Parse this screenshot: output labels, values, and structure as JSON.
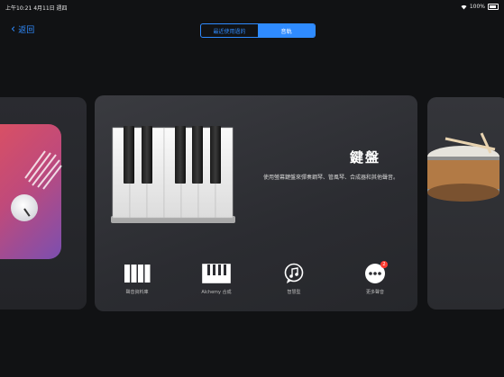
{
  "status_bar": {
    "time_date": "上午10:21  4月11日 週四",
    "battery": "100%"
  },
  "nav": {
    "back_label": "返回",
    "segments": [
      "最近使用過的",
      "音軌"
    ],
    "active_segment": 1
  },
  "instrument": {
    "title": "鍵盤",
    "description": "使用螢幕鍵盤來彈奏鋼琴、管風琴、合成器和其他聲音。"
  },
  "sub_options": [
    {
      "label": "聲音資料庫",
      "icon": "grid-keyboard-icon"
    },
    {
      "label": "Alchemy 合成",
      "icon": "piano-keys-icon"
    },
    {
      "label": "智慧型",
      "icon": "music-note-bubble-icon"
    },
    {
      "label": "更多聲音",
      "icon": "more-ellipsis-icon",
      "badge": "2"
    }
  ],
  "colors": {
    "accent": "#2f8bff",
    "badge": "#ff3b30"
  }
}
